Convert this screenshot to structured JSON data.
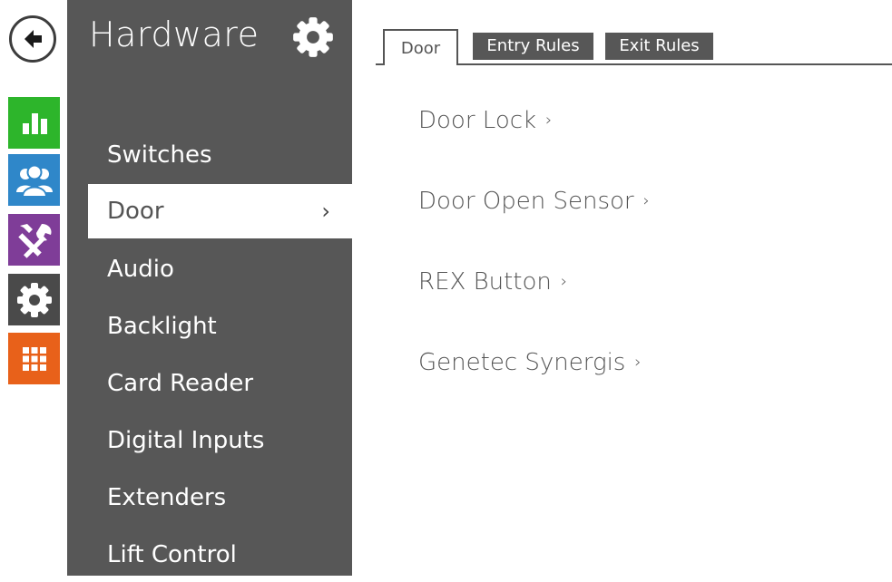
{
  "rail": {
    "back_icon": "back-arrow-icon",
    "items": [
      {
        "name": "status",
        "icon": "bar-chart-icon",
        "color": "#2db52b"
      },
      {
        "name": "users",
        "icon": "users-icon",
        "color": "#2f87c9"
      },
      {
        "name": "hardware",
        "icon": "tools-icon",
        "color": "#7f3d98"
      },
      {
        "name": "settings",
        "icon": "gear-icon",
        "color": "#4a4a4a"
      },
      {
        "name": "apps",
        "icon": "grid-icon",
        "color": "#e8611a"
      }
    ]
  },
  "menu": {
    "title": "Hardware",
    "title_icon": "gear-icon",
    "active_index": 1,
    "items": [
      {
        "label": "Switches"
      },
      {
        "label": "Door"
      },
      {
        "label": "Audio"
      },
      {
        "label": "Backlight"
      },
      {
        "label": "Card Reader"
      },
      {
        "label": "Digital Inputs"
      },
      {
        "label": "Extenders"
      },
      {
        "label": "Lift Control"
      }
    ],
    "active_chevron": "›"
  },
  "tabs": [
    {
      "label": "Door",
      "active": true
    },
    {
      "label": "Entry Rules",
      "active": false
    },
    {
      "label": "Exit Rules",
      "active": false
    }
  ],
  "content": {
    "links": [
      {
        "label": "Door Lock",
        "chevron": "›"
      },
      {
        "label": "Door Open Sensor",
        "chevron": "›"
      },
      {
        "label": "REX Button",
        "chevron": "›"
      },
      {
        "label": "Genetec Synergis",
        "chevron": "›"
      }
    ]
  }
}
